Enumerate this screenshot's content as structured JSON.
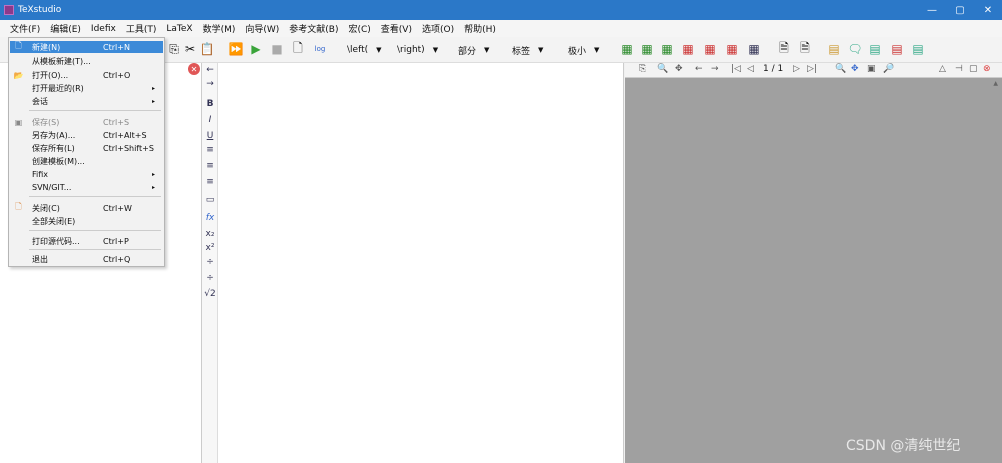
{
  "window": {
    "title": "TeXstudio",
    "min": "—",
    "max": "▢",
    "close": "✕"
  },
  "menubar": [
    "文件(F)",
    "编辑(E)",
    "Idefix",
    "工具(T)",
    "LaTeX",
    "数学(M)",
    "向导(W)",
    "参考文献(B)",
    "宏(C)",
    "查看(V)",
    "选项(O)",
    "帮助(H)"
  ],
  "toolbar": {
    "combos": [
      "\\left(",
      "\\right)",
      "部分",
      "标签",
      "极小"
    ],
    "icons": [
      "copy-icon",
      "cut-icon",
      "paste-icon",
      "build-run-icon",
      "compile-icon",
      "stop-icon",
      "view-icon",
      "log-icon"
    ],
    "log_label": "log"
  },
  "file_menu": {
    "items": [
      {
        "label": "新建(N)",
        "shortcut": "Ctrl+N",
        "icon": "new-file-icon",
        "highlight": true
      },
      {
        "label": "从模板新建(T)...",
        "shortcut": ""
      },
      {
        "label": "打开(O)...",
        "shortcut": "Ctrl+O",
        "icon": "open-folder-icon"
      },
      {
        "label": "打开最近的(R)",
        "shortcut": "",
        "submenu": true
      },
      {
        "label": "会话",
        "shortcut": "",
        "submenu": true
      },
      {
        "label": "保存(S)",
        "shortcut": "Ctrl+S",
        "icon": "save-icon",
        "disabled": true
      },
      {
        "label": "另存为(A)...",
        "shortcut": "Ctrl+Alt+S"
      },
      {
        "label": "保存所有(L)",
        "shortcut": "Ctrl+Shift+S"
      },
      {
        "label": "创建模板(M)...",
        "shortcut": ""
      },
      {
        "label": "Fifix",
        "shortcut": "",
        "submenu": true
      },
      {
        "label": "SVN/GIT...",
        "shortcut": "",
        "submenu": true
      },
      {
        "label": "关闭(C)",
        "shortcut": "Ctrl+W",
        "icon": "close-doc-icon"
      },
      {
        "label": "全部关闭(E)",
        "shortcut": ""
      },
      {
        "label": "打印源代码...",
        "shortcut": "Ctrl+P"
      },
      {
        "label": "退出",
        "shortcut": "Ctrl+Q"
      }
    ]
  },
  "sidebar": [
    "←",
    "→",
    "B",
    "I",
    "U",
    "≡",
    "≡",
    "≡",
    "▭",
    "fx",
    "x₂",
    "x²",
    "÷",
    "÷",
    "√2"
  ],
  "pdf": {
    "page": "1 / 1"
  },
  "watermark": "CSDN @清纯世纪"
}
